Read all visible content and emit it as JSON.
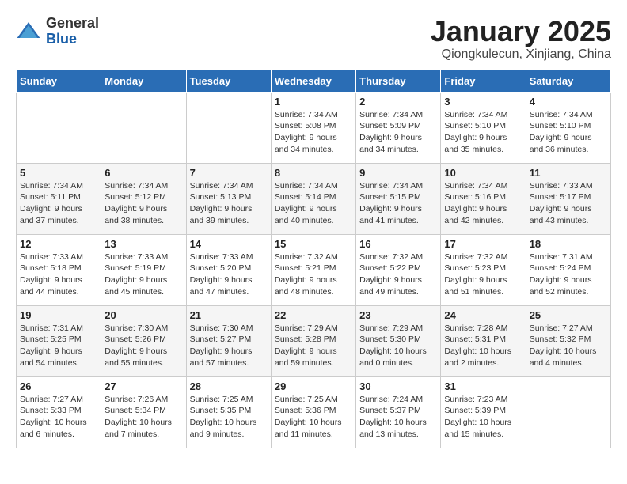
{
  "header": {
    "logo_line1": "General",
    "logo_line2": "Blue",
    "title": "January 2025",
    "subtitle": "Qiongkulecun, Xinjiang, China"
  },
  "calendar": {
    "weekdays": [
      "Sunday",
      "Monday",
      "Tuesday",
      "Wednesday",
      "Thursday",
      "Friday",
      "Saturday"
    ],
    "weeks": [
      [
        {
          "day": "",
          "info": ""
        },
        {
          "day": "",
          "info": ""
        },
        {
          "day": "",
          "info": ""
        },
        {
          "day": "1",
          "info": "Sunrise: 7:34 AM\nSunset: 5:08 PM\nDaylight: 9 hours\nand 34 minutes."
        },
        {
          "day": "2",
          "info": "Sunrise: 7:34 AM\nSunset: 5:09 PM\nDaylight: 9 hours\nand 34 minutes."
        },
        {
          "day": "3",
          "info": "Sunrise: 7:34 AM\nSunset: 5:10 PM\nDaylight: 9 hours\nand 35 minutes."
        },
        {
          "day": "4",
          "info": "Sunrise: 7:34 AM\nSunset: 5:10 PM\nDaylight: 9 hours\nand 36 minutes."
        }
      ],
      [
        {
          "day": "5",
          "info": "Sunrise: 7:34 AM\nSunset: 5:11 PM\nDaylight: 9 hours\nand 37 minutes."
        },
        {
          "day": "6",
          "info": "Sunrise: 7:34 AM\nSunset: 5:12 PM\nDaylight: 9 hours\nand 38 minutes."
        },
        {
          "day": "7",
          "info": "Sunrise: 7:34 AM\nSunset: 5:13 PM\nDaylight: 9 hours\nand 39 minutes."
        },
        {
          "day": "8",
          "info": "Sunrise: 7:34 AM\nSunset: 5:14 PM\nDaylight: 9 hours\nand 40 minutes."
        },
        {
          "day": "9",
          "info": "Sunrise: 7:34 AM\nSunset: 5:15 PM\nDaylight: 9 hours\nand 41 minutes."
        },
        {
          "day": "10",
          "info": "Sunrise: 7:34 AM\nSunset: 5:16 PM\nDaylight: 9 hours\nand 42 minutes."
        },
        {
          "day": "11",
          "info": "Sunrise: 7:33 AM\nSunset: 5:17 PM\nDaylight: 9 hours\nand 43 minutes."
        }
      ],
      [
        {
          "day": "12",
          "info": "Sunrise: 7:33 AM\nSunset: 5:18 PM\nDaylight: 9 hours\nand 44 minutes."
        },
        {
          "day": "13",
          "info": "Sunrise: 7:33 AM\nSunset: 5:19 PM\nDaylight: 9 hours\nand 45 minutes."
        },
        {
          "day": "14",
          "info": "Sunrise: 7:33 AM\nSunset: 5:20 PM\nDaylight: 9 hours\nand 47 minutes."
        },
        {
          "day": "15",
          "info": "Sunrise: 7:32 AM\nSunset: 5:21 PM\nDaylight: 9 hours\nand 48 minutes."
        },
        {
          "day": "16",
          "info": "Sunrise: 7:32 AM\nSunset: 5:22 PM\nDaylight: 9 hours\nand 49 minutes."
        },
        {
          "day": "17",
          "info": "Sunrise: 7:32 AM\nSunset: 5:23 PM\nDaylight: 9 hours\nand 51 minutes."
        },
        {
          "day": "18",
          "info": "Sunrise: 7:31 AM\nSunset: 5:24 PM\nDaylight: 9 hours\nand 52 minutes."
        }
      ],
      [
        {
          "day": "19",
          "info": "Sunrise: 7:31 AM\nSunset: 5:25 PM\nDaylight: 9 hours\nand 54 minutes."
        },
        {
          "day": "20",
          "info": "Sunrise: 7:30 AM\nSunset: 5:26 PM\nDaylight: 9 hours\nand 55 minutes."
        },
        {
          "day": "21",
          "info": "Sunrise: 7:30 AM\nSunset: 5:27 PM\nDaylight: 9 hours\nand 57 minutes."
        },
        {
          "day": "22",
          "info": "Sunrise: 7:29 AM\nSunset: 5:28 PM\nDaylight: 9 hours\nand 59 minutes."
        },
        {
          "day": "23",
          "info": "Sunrise: 7:29 AM\nSunset: 5:30 PM\nDaylight: 10 hours\nand 0 minutes."
        },
        {
          "day": "24",
          "info": "Sunrise: 7:28 AM\nSunset: 5:31 PM\nDaylight: 10 hours\nand 2 minutes."
        },
        {
          "day": "25",
          "info": "Sunrise: 7:27 AM\nSunset: 5:32 PM\nDaylight: 10 hours\nand 4 minutes."
        }
      ],
      [
        {
          "day": "26",
          "info": "Sunrise: 7:27 AM\nSunset: 5:33 PM\nDaylight: 10 hours\nand 6 minutes."
        },
        {
          "day": "27",
          "info": "Sunrise: 7:26 AM\nSunset: 5:34 PM\nDaylight: 10 hours\nand 7 minutes."
        },
        {
          "day": "28",
          "info": "Sunrise: 7:25 AM\nSunset: 5:35 PM\nDaylight: 10 hours\nand 9 minutes."
        },
        {
          "day": "29",
          "info": "Sunrise: 7:25 AM\nSunset: 5:36 PM\nDaylight: 10 hours\nand 11 minutes."
        },
        {
          "day": "30",
          "info": "Sunrise: 7:24 AM\nSunset: 5:37 PM\nDaylight: 10 hours\nand 13 minutes."
        },
        {
          "day": "31",
          "info": "Sunrise: 7:23 AM\nSunset: 5:39 PM\nDaylight: 10 hours\nand 15 minutes."
        },
        {
          "day": "",
          "info": ""
        }
      ]
    ]
  }
}
